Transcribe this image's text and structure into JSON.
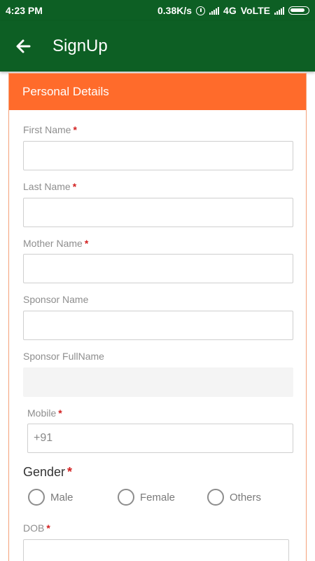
{
  "status_bar": {
    "time": "4:23 PM",
    "net_speed": "0.38K/s",
    "network_4g": "4G",
    "volte": "VoLTE"
  },
  "app_bar": {
    "title": "SignUp",
    "back_icon": "arrow-left-icon"
  },
  "card": {
    "header": "Personal Details"
  },
  "form": {
    "first_name": {
      "label": "First Name",
      "required": "*",
      "value": ""
    },
    "last_name": {
      "label": "Last Name",
      "required": "*",
      "value": ""
    },
    "mother_name": {
      "label": "Mother Name",
      "required": "*",
      "value": ""
    },
    "sponsor_name": {
      "label": "Sponsor Name",
      "value": ""
    },
    "sponsor_fullname": {
      "label": "Sponsor FullName",
      "value": ""
    },
    "mobile": {
      "label": "Mobile",
      "required": "*",
      "value": "+91"
    },
    "gender": {
      "label": "Gender",
      "required": "*",
      "options": [
        "Male",
        "Female",
        "Others"
      ]
    },
    "dob": {
      "label": "DOB",
      "required": "*",
      "value": ""
    }
  },
  "colors": {
    "app_bar": "#0d5f24",
    "card_header": "#ff6b2b",
    "required": "#d21f1f"
  }
}
